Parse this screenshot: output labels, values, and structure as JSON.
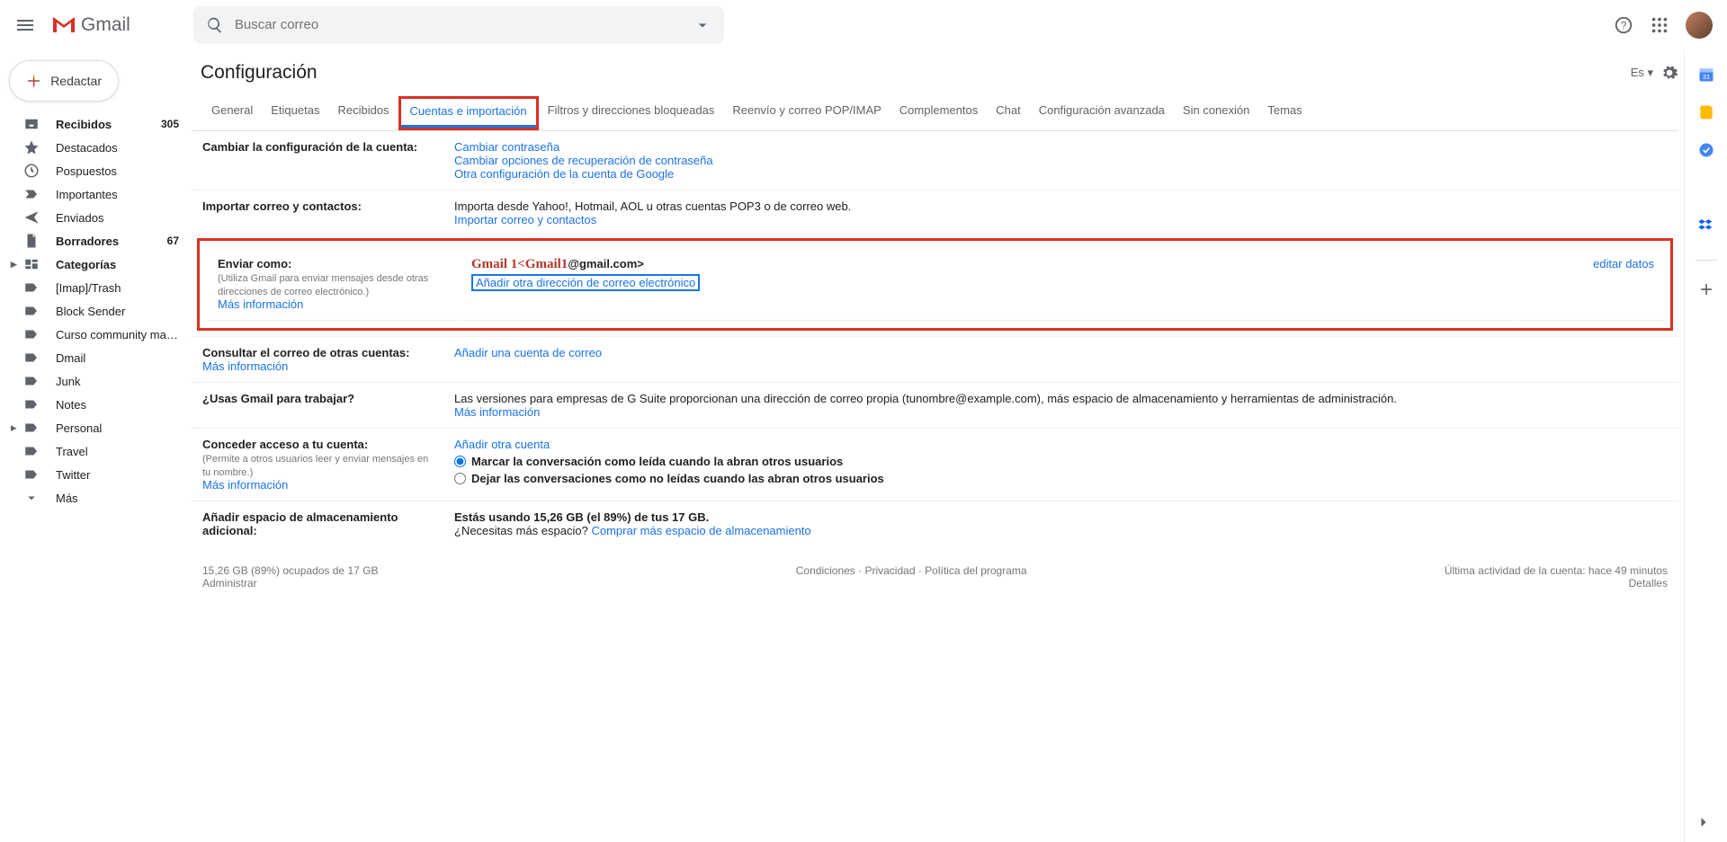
{
  "header": {
    "gmail_label": "Gmail",
    "search_placeholder": "Buscar correo",
    "lang": "Es"
  },
  "compose_label": "Redactar",
  "sidebar": [
    {
      "label": "Recibidos",
      "count": "305",
      "bold": true,
      "icon": "inbox"
    },
    {
      "label": "Destacados",
      "icon": "star"
    },
    {
      "label": "Pospuestos",
      "icon": "clock"
    },
    {
      "label": "Importantes",
      "icon": "important"
    },
    {
      "label": "Enviados",
      "icon": "sent"
    },
    {
      "label": "Borradores",
      "count": "67",
      "bold": true,
      "icon": "draft"
    },
    {
      "label": "Categorías",
      "bold": true,
      "icon": "categories",
      "chev": true
    },
    {
      "label": "[Imap]/Trash",
      "icon": "label"
    },
    {
      "label": "Block Sender",
      "icon": "label"
    },
    {
      "label": "Curso community mana...",
      "icon": "label"
    },
    {
      "label": "Dmail",
      "icon": "label"
    },
    {
      "label": "Junk",
      "icon": "label"
    },
    {
      "label": "Notes",
      "icon": "label"
    },
    {
      "label": "Personal",
      "icon": "label",
      "chev": true
    },
    {
      "label": "Travel",
      "icon": "label"
    },
    {
      "label": "Twitter",
      "icon": "label"
    },
    {
      "label": "Más",
      "icon": "more"
    }
  ],
  "page_title": "Configuración",
  "tabs": [
    "General",
    "Etiquetas",
    "Recibidos",
    "Cuentas e importación",
    "Filtros y direcciones bloqueadas",
    "Reenvío y correo POP/IMAP",
    "Complementos",
    "Chat",
    "Configuración avanzada",
    "Sin conexión",
    "Temas"
  ],
  "active_tab_index": 3,
  "sections": {
    "change_account": {
      "title": "Cambiar la configuración de la cuenta:",
      "links": [
        "Cambiar contraseña",
        "Cambiar opciones de recuperación de contraseña",
        "Otra configuración de la cuenta de Google"
      ]
    },
    "import_mail": {
      "title": "Importar correo y contactos:",
      "desc": "Importa desde Yahoo!, Hotmail, AOL u otras cuentas POP3 o de correo web.",
      "link": "Importar correo y contactos"
    },
    "send_as": {
      "title": "Enviar como:",
      "subtitle": "(Utiliza Gmail para enviar mensajes desde otras direcciones de correo electrónico.)",
      "more": "Más información",
      "name": "Gmail 1",
      "lt": "<",
      "email_local": "Gmail1",
      "email_domain": "@gmail.com>",
      "add_link": "Añadir otra dirección de correo electrónico",
      "edit": "editar datos"
    },
    "check_other": {
      "title": "Consultar el correo de otras cuentas:",
      "more": "Más información",
      "link": "Añadir una cuenta de correo"
    },
    "gsuite": {
      "title": "¿Usas Gmail para trabajar?",
      "desc": "Las versiones para empresas de G Suite proporcionan una dirección de correo propia (tunombre@example.com), más espacio de almacenamiento y herramientas de administración.",
      "more": "Más información"
    },
    "grant": {
      "title": "Conceder acceso a tu cuenta:",
      "subtitle": "(Permite a otros usuarios leer y enviar mensajes en tu nombre.)",
      "more": "Más información",
      "add": "Añadir otra cuenta",
      "radio1": "Marcar la conversación como leída cuando la abran otros usuarios",
      "radio2": "Dejar las conversaciones como no leídas cuando las abran otros usuarios"
    },
    "storage": {
      "title": "Añadir espacio de almacenamiento adicional:",
      "line1": "Estás usando 15,26 GB (el 89%) de tus 17 GB.",
      "line2a": "¿Necesitas más espacio? ",
      "line2b": "Comprar más espacio de almacenamiento"
    }
  },
  "footer": {
    "storage": "15,26 GB (89%) ocupados de 17 GB",
    "manage": "Administrar",
    "terms": "Condiciones",
    "privacy": "Privacidad",
    "policy": "Política del programa",
    "activity": "Última actividad de la cuenta: hace 49 minutos",
    "details": "Detalles"
  }
}
